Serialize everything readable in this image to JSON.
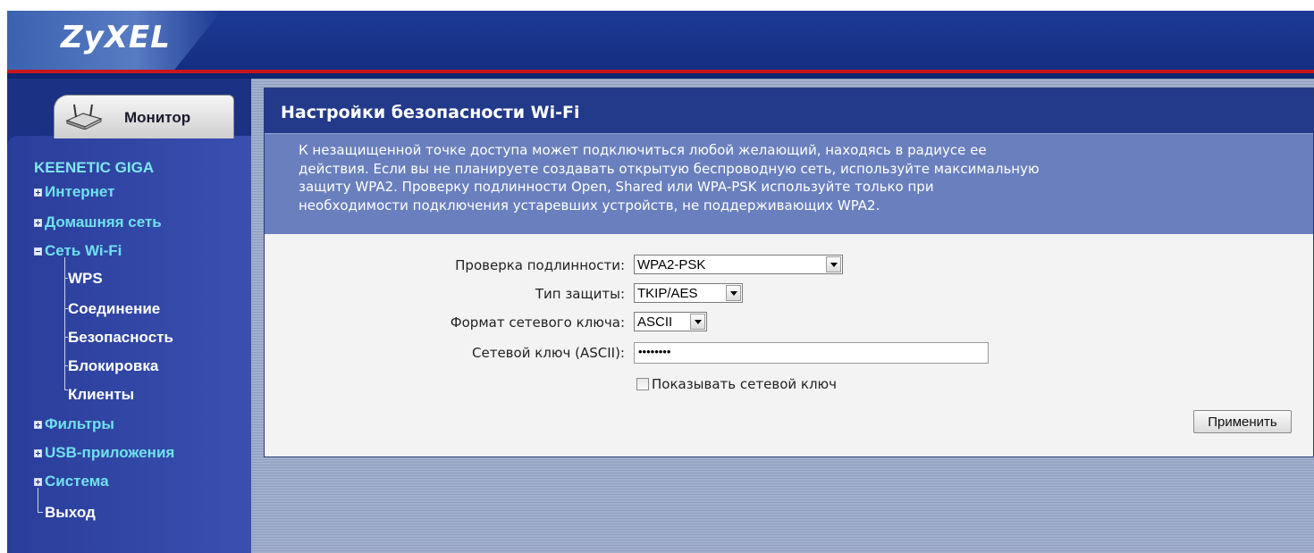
{
  "header": {
    "logo": "ZyXEL"
  },
  "sidebar": {
    "tab_label": "Монитор",
    "device_name": "KEENETIC GIGA",
    "menu": [
      {
        "label": "Интернет",
        "expanded": false
      },
      {
        "label": "Домашняя сеть",
        "expanded": false
      },
      {
        "label": "Сеть Wi-Fi",
        "expanded": true,
        "children": [
          "WPS",
          "Соединение",
          "Безопасность",
          "Блокировка",
          "Клиенты"
        ]
      },
      {
        "label": "Фильтры",
        "expanded": false
      },
      {
        "label": "USB-приложения",
        "expanded": false
      },
      {
        "label": "Система",
        "expanded": false
      }
    ],
    "logout": "Выход"
  },
  "main": {
    "title": "Настройки безопасности Wi-Fi",
    "description_lines": [
      "К незащищенной точке доступа может подключиться любой желающий, находясь в радиусе ее",
      "действия. Если вы не планируете создавать открытую беспроводную сеть, используйте максимальную",
      "защиту WPA2. Проверку подлинности Open, Shared или WPA-PSK используйте только при",
      "необходимости подключения устаревших устройств, не поддерживающих WPA2."
    ],
    "form": {
      "auth_label": "Проверка подлинности:",
      "auth_value": "WPA2-PSK",
      "security_label": "Тип защиты:",
      "security_value": "TKIP/AES",
      "key_format_label": "Формат сетевого ключа:",
      "key_format_value": "ASCII",
      "key_label": "Сетевой ключ (ASCII):",
      "key_value": "••••••••",
      "show_key_label": "Показывать сетевой ключ",
      "show_key_checked": false
    },
    "apply_label": "Применить"
  },
  "colors": {
    "header_blue": "#1d3a94",
    "header_red_rule": "#c8161d",
    "menu_link": "#6fe1ee",
    "desc_box": "#6a7fbd"
  }
}
